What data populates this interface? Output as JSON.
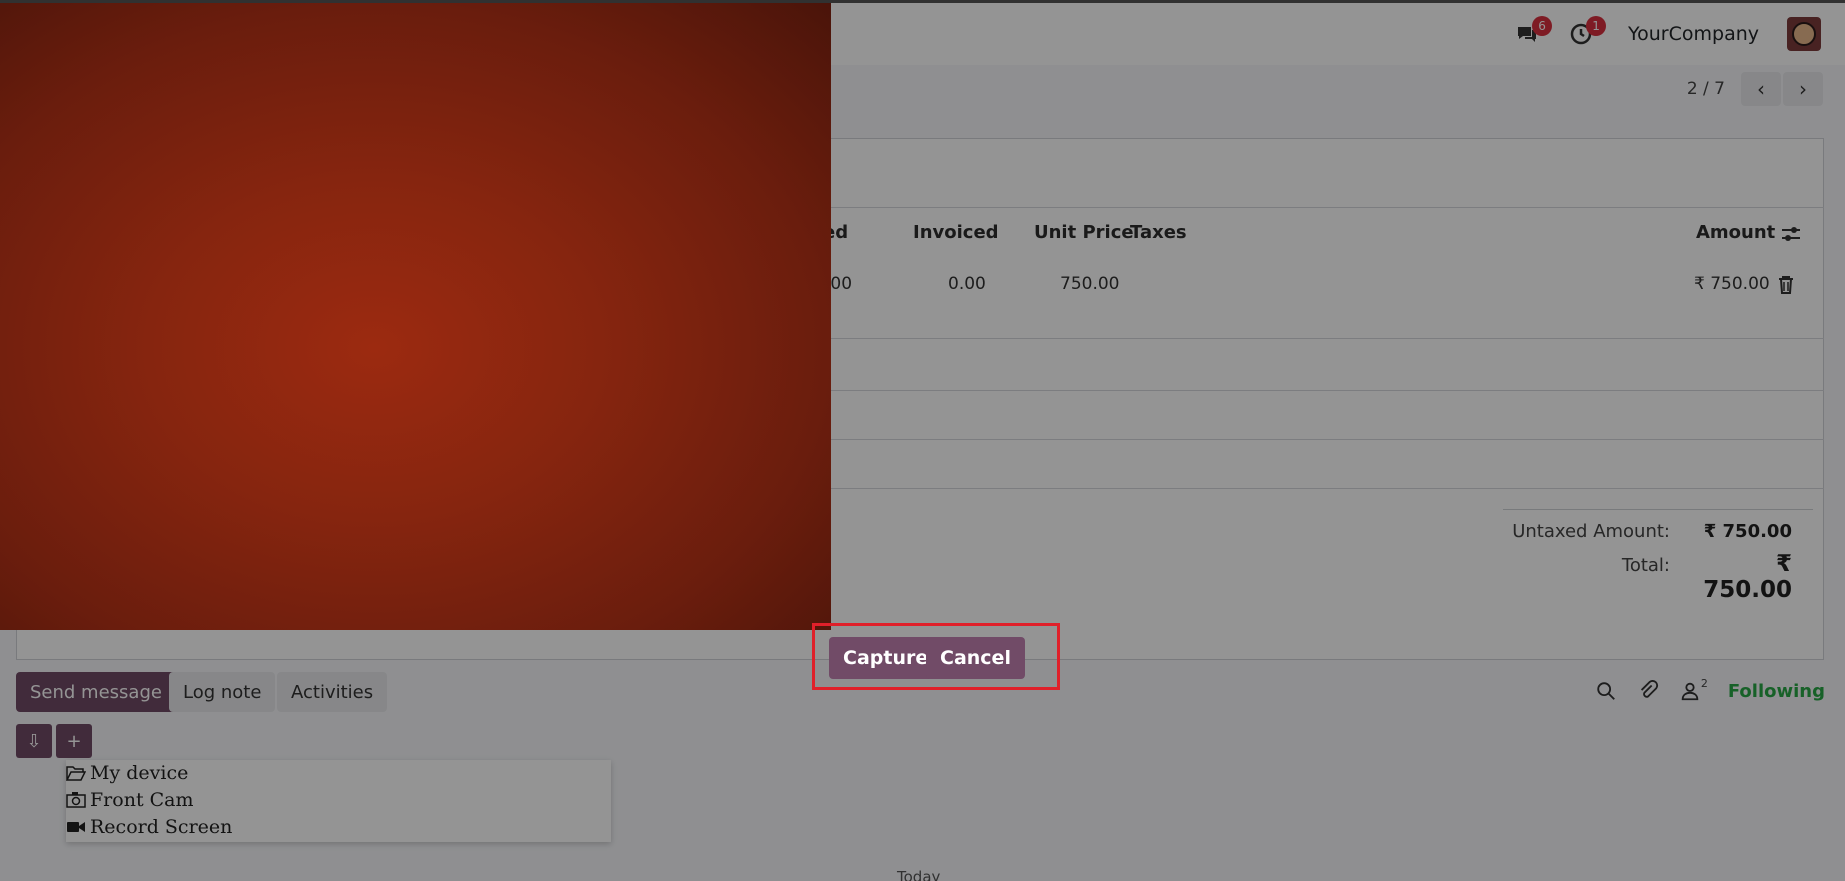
{
  "topbar": {
    "messages_count": "6",
    "activities_count": "1",
    "company_name": "YourCompany"
  },
  "pager": {
    "text": "2 / 7"
  },
  "table": {
    "headers": [
      "ed",
      "Invoiced",
      "Unit Price",
      "Taxes",
      "Amount"
    ],
    "row": {
      "qty_fragment": ".00",
      "invoiced": "0.00",
      "unit_price": "750.00",
      "amount": "₹ 750.00"
    }
  },
  "totals": {
    "untaxed_label": "Untaxed Amount:",
    "untaxed_value": "₹ 750.00",
    "total_label": "Total:",
    "total_value": "₹ 750.00"
  },
  "chatter": {
    "send_message": "Send message",
    "log_note": "Log note",
    "activities": "Activities",
    "followers_count": "2",
    "following": "Following",
    "today": "Today"
  },
  "attach_menu": {
    "items": [
      "My device",
      "Front Cam",
      "Record Screen"
    ]
  },
  "camera": {
    "capture_label": "Capture",
    "cancel_label": "Cancel"
  },
  "colors": {
    "primary": "#714b67",
    "highlight": "#e0202a",
    "badge": "#d9303e",
    "following": "#28a745"
  }
}
